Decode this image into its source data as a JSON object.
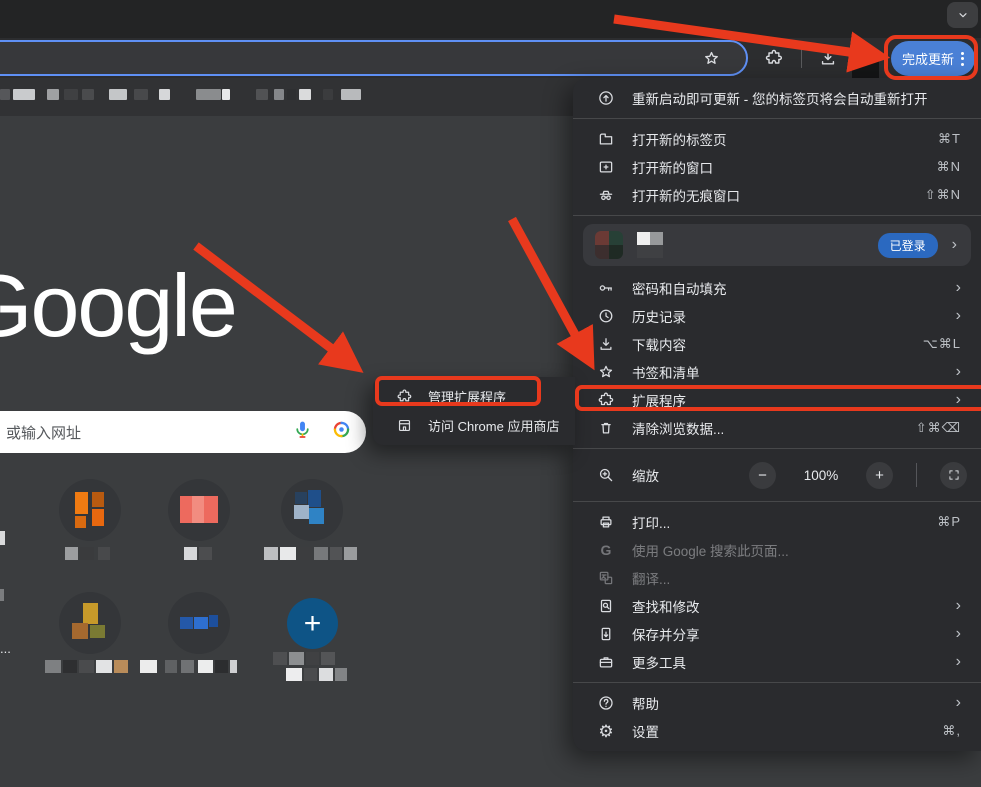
{
  "toolbar": {
    "update_button_label": "完成更新"
  },
  "page": {
    "logo": "Google",
    "search_placeholder": "或输入网址",
    "cutoff_label": "...",
    "add_shortcut_plus": "+"
  },
  "profile": {
    "badge": "已登录"
  },
  "menu": {
    "update_banner": {
      "label": "重新启动即可更新 - 您的标签页将会自动重新打开"
    },
    "items": [
      {
        "label": "打开新的标签页",
        "shortcut": "⌘T"
      },
      {
        "label": "打开新的窗口",
        "shortcut": "⌘N"
      },
      {
        "label": "打开新的无痕窗口",
        "shortcut": "⇧⌘N"
      },
      {
        "label": "密码和自动填充"
      },
      {
        "label": "历史记录"
      },
      {
        "label": "下载内容",
        "shortcut": "⌥⌘L"
      },
      {
        "label": "书签和清单"
      },
      {
        "label": "扩展程序"
      },
      {
        "label": "清除浏览数据...",
        "shortcut": "⇧⌘⌫"
      },
      {
        "label": "缩放",
        "value": "100%"
      },
      {
        "label": "打印...",
        "shortcut": "⌘P"
      },
      {
        "label": "使用 Google 搜索此页面..."
      },
      {
        "label": "翻译..."
      },
      {
        "label": "查找和修改"
      },
      {
        "label": "保存并分享"
      },
      {
        "label": "更多工具"
      },
      {
        "label": "帮助"
      },
      {
        "label": "设置",
        "shortcut": "⌘,"
      }
    ]
  },
  "submenu": {
    "items": [
      {
        "label": "管理扩展程序"
      },
      {
        "label": "访问 Chrome 应用商店"
      }
    ]
  },
  "colors": {
    "annotation_red": "#e8391d",
    "update_button_blue": "#4a80d6",
    "signed_in_badge_blue": "#2b69c0",
    "omnibox_focus_blue": "#5f90f5",
    "add_shortcut_circle_blue": "#0e5486"
  }
}
